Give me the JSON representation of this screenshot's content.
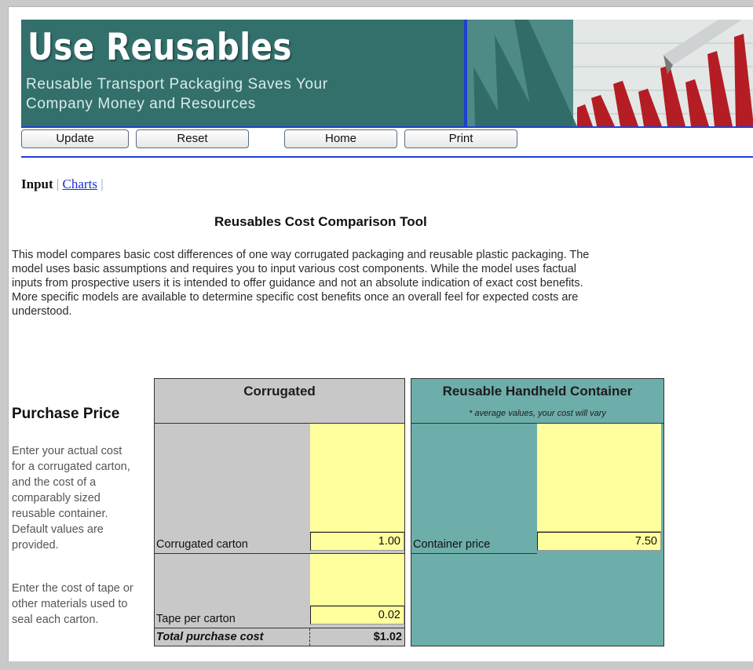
{
  "banner": {
    "title": "Use Reusables",
    "tagline_line1": "Reusable Transport Packaging Saves Your",
    "tagline_line2": "Company Money and Resources"
  },
  "toolbar": {
    "update_label": "Update",
    "reset_label": "Reset",
    "home_label": "Home",
    "print_label": "Print"
  },
  "tabs": {
    "input_label": "Input",
    "separator": "|",
    "charts_label": "Charts"
  },
  "page_title": "Reusables Cost Comparison Tool",
  "intro": {
    "line1": "This model compares basic cost differences of one way corrugated packaging and reusable plastic packaging. The",
    "line2": "model uses basic assumptions and requires you to input various cost components. While the model uses factual",
    "line3": "inputs from prospective users it is intended to offer guidance and not an absolute indication of exact cost benefits.",
    "line4": "More specific models are available to determine specific cost benefits once an overall feel for expected costs are",
    "line5": "understood."
  },
  "section": {
    "title": "Purchase Price",
    "help_price": {
      "l1": "Enter your actual cost",
      "l2": "for a corrugated carton,",
      "l3": "and the cost of a",
      "l4": "comparably sized",
      "l5": "reusable container.",
      "l6": "Default values are",
      "l7": "provided."
    },
    "help_tape": {
      "l1": "Enter the cost of tape or",
      "l2": "other materials used to",
      "l3": "seal each carton."
    }
  },
  "corrugated": {
    "header": "Corrugated",
    "carton_label": "Corrugated carton",
    "carton_value": "1.00",
    "tape_label": "Tape per carton",
    "tape_value": "0.02",
    "total_label": "Total purchase cost",
    "total_value": "$1.02"
  },
  "reusable": {
    "header": "Reusable Handheld Container",
    "note": "* average values, your cost will vary",
    "container_label": "Container price",
    "container_value": "7.50"
  },
  "colors": {
    "banner": "#33706c",
    "toolbar_line": "#2040d8",
    "corrugated_panel": "#c8c8c8",
    "reusable_panel": "#6dadaa",
    "input_yellow": "#ffff9e",
    "link": "#1a2fd6"
  }
}
